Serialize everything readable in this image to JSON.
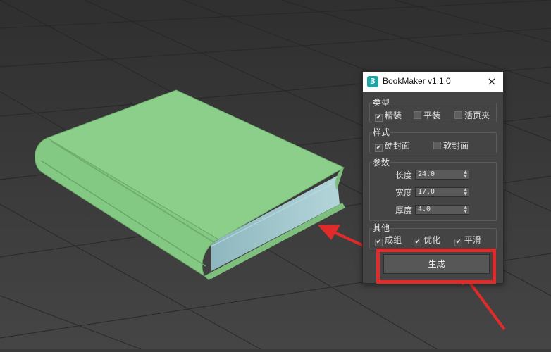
{
  "dialog": {
    "icon_label": "3",
    "title": "BookMaker v1.1.0",
    "close_icon": "×",
    "groups": {
      "type": {
        "label": "类型",
        "options": [
          {
            "label": "精装",
            "checked": true
          },
          {
            "label": "平装",
            "checked": false
          },
          {
            "label": "活页夹",
            "checked": false
          }
        ]
      },
      "style": {
        "label": "样式",
        "options": [
          {
            "label": "硬封面",
            "checked": true
          },
          {
            "label": "软封面",
            "checked": false
          }
        ]
      },
      "params": {
        "label": "参数",
        "fields": [
          {
            "label": "长度",
            "value": "24.0"
          },
          {
            "label": "宽度",
            "value": "17.0"
          },
          {
            "label": "厚度",
            "value": "4.0"
          }
        ]
      },
      "other": {
        "label": "其他",
        "options": [
          {
            "label": "成组",
            "checked": true
          },
          {
            "label": "优化",
            "checked": true
          },
          {
            "label": "平滑",
            "checked": true
          }
        ]
      }
    },
    "generate_label": "生成"
  },
  "icons": {
    "check": "✔",
    "spinner_up": "▲",
    "spinner_down": "▼"
  },
  "colors": {
    "book_cover": "#8ccf8a",
    "book_pages": "#9fc9cf",
    "annotation_red": "#e12b2b",
    "viewport_bg": "#3a3a3a"
  }
}
